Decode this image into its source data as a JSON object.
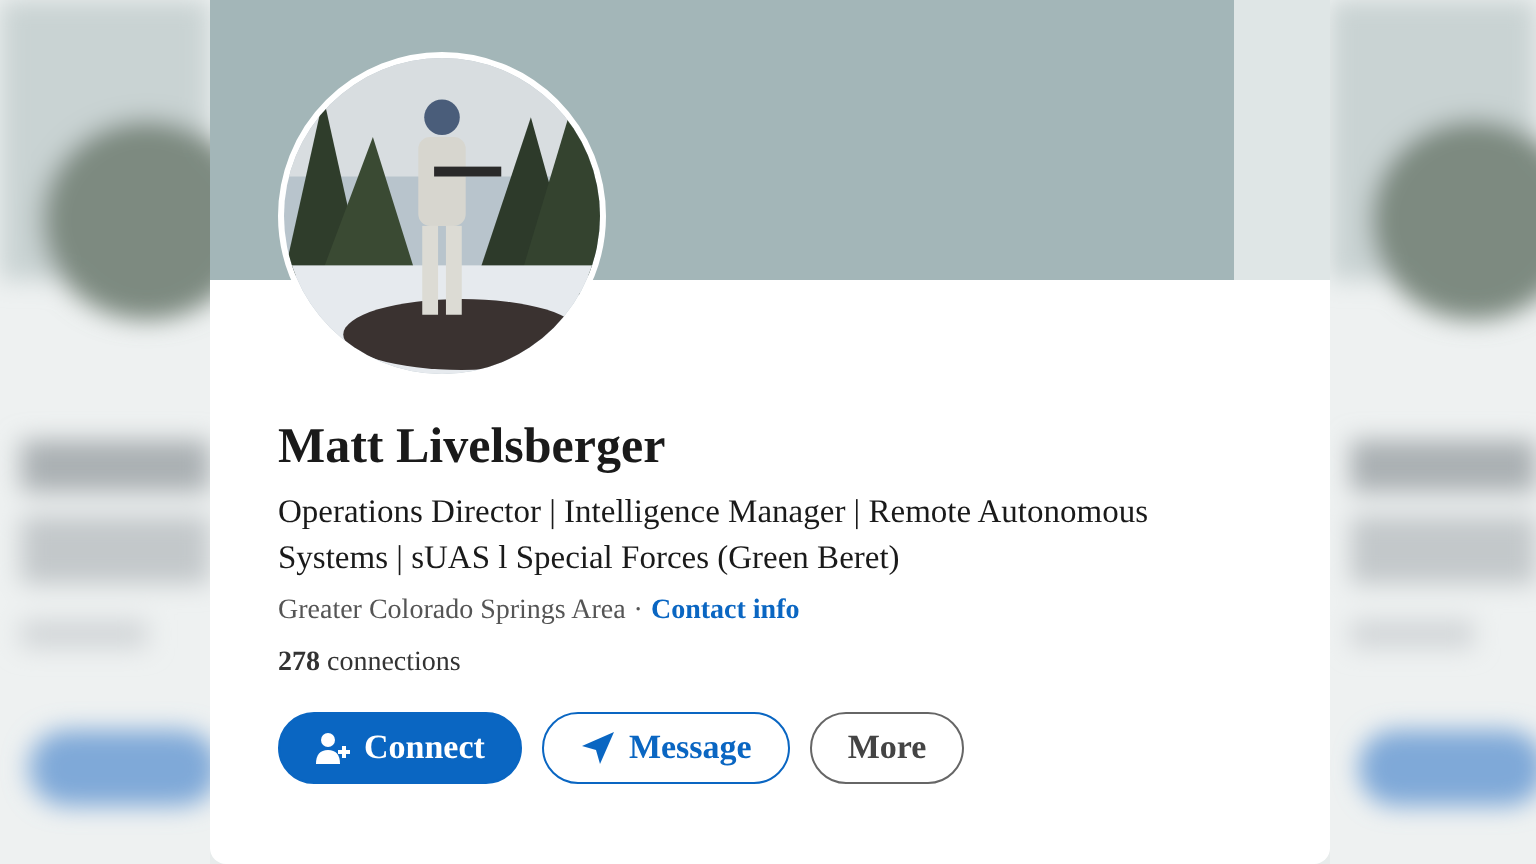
{
  "profile": {
    "name": "Matt Livelsberger",
    "headline": "Operations Director | Intelligence Manager | Remote Autonomous Systems | sUAS l Special Forces (Green Beret)",
    "location": "Greater Colorado Springs Area",
    "separator": "·",
    "contact_link": "Contact info",
    "connections": "**278** connections"
  },
  "buttons": [
    {
      "label": "Connect",
      "kind": "primary"
    },
    {
      "label": "Message",
      "kind": "secondary"
    },
    {
      "label": "More",
      "kind": "plain"
    }
  ]
}
